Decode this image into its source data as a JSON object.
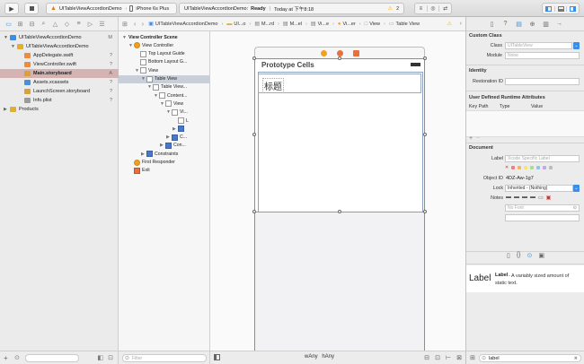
{
  "toolbar": {
    "scheme_project": "UITableViewAccordionDemo",
    "scheme_device": "iPhone 6s Plus",
    "status_project": "UITableViewAccordionDemo:",
    "status_state": "Ready",
    "status_time": "Today at 下午8:18",
    "warning_count": "2"
  },
  "jumpbar": [
    "UITableViewAccordionDemo",
    "UI...o",
    "M...rd",
    "M...el",
    "Vi...e",
    "Vi...er",
    "View",
    "Table View"
  ],
  "navigator": {
    "items": [
      {
        "label": "UITableViewAccordionDemo",
        "status": "M",
        "indent": 0,
        "kind": "project"
      },
      {
        "label": "UITableViewAccordionDemo",
        "status": "",
        "indent": 1,
        "kind": "folder"
      },
      {
        "label": "AppDelegate.swift",
        "status": "?",
        "indent": 2,
        "kind": "swift"
      },
      {
        "label": "ViewController.swift",
        "status": "?",
        "indent": 2,
        "kind": "swift"
      },
      {
        "label": "Main.storyboard",
        "status": "A",
        "indent": 2,
        "kind": "storyboard",
        "selected": true
      },
      {
        "label": "Assets.xcassets",
        "status": "?",
        "indent": 2,
        "kind": "assets"
      },
      {
        "label": "LaunchScreen.storyboard",
        "status": "?",
        "indent": 2,
        "kind": "storyboard"
      },
      {
        "label": "Info.plist",
        "status": "?",
        "indent": 2,
        "kind": "plist"
      },
      {
        "label": "Products",
        "status": "",
        "indent": 0,
        "kind": "folder"
      }
    ],
    "filter_placeholder": "Filter"
  },
  "outline": {
    "items": [
      {
        "label": "View Controller Scene",
        "indent": 0,
        "bold": true
      },
      {
        "label": "View Controller",
        "indent": 1
      },
      {
        "label": "Top Layout Guide",
        "indent": 2
      },
      {
        "label": "Bottom Layout G...",
        "indent": 2
      },
      {
        "label": "View",
        "indent": 2
      },
      {
        "label": "Table View",
        "indent": 3,
        "selected": true
      },
      {
        "label": "Table View...",
        "indent": 4
      },
      {
        "label": "Content...",
        "indent": 5
      },
      {
        "label": "View",
        "indent": 6
      },
      {
        "label": "Vi...",
        "indent": 7
      },
      {
        "label": "L",
        "indent": 8
      },
      {
        "label": "",
        "indent": 8
      },
      {
        "label": "C...",
        "indent": 7
      },
      {
        "label": "Con...",
        "indent": 6
      },
      {
        "label": "Constraints",
        "indent": 3
      },
      {
        "label": "First Responder",
        "indent": 1
      },
      {
        "label": "Exit",
        "indent": 1
      }
    ],
    "filter_placeholder": "Filter"
  },
  "canvas": {
    "prototype_header": "Prototype Cells",
    "cell_label": "标题",
    "size_w": "wAny",
    "size_h": "hAny"
  },
  "inspector": {
    "custom_class_title": "Custom Class",
    "class_label": "Class",
    "class_placeholder": "UITableView",
    "module_label": "Module",
    "module_placeholder": "None",
    "identity_title": "Identity",
    "restoration_label": "Restoration ID",
    "udra_title": "User Defined Runtime Attributes",
    "col_key": "Key Path",
    "col_type": "Type",
    "col_value": "Value",
    "document_title": "Document",
    "doc_label_label": "Label",
    "doc_label_placeholder": "Xcode Specific Label",
    "object_id_label": "Object ID",
    "object_id": "4DZ-Aw-1g7",
    "lock_label": "Lock",
    "lock_value": "Inherited - (Nothing)",
    "notes_label": "Notes",
    "font_placeholder": "No Font",
    "library_title": "Label",
    "library_desc": "- A variably sized amount of static text.",
    "library_icon_text": "Label",
    "search_value": "label"
  },
  "colors": {
    "selection": "#c9cfd8",
    "nav_selected": "#d5b3b3",
    "accent": "#3b8ee8",
    "warning": "#f0b400"
  }
}
